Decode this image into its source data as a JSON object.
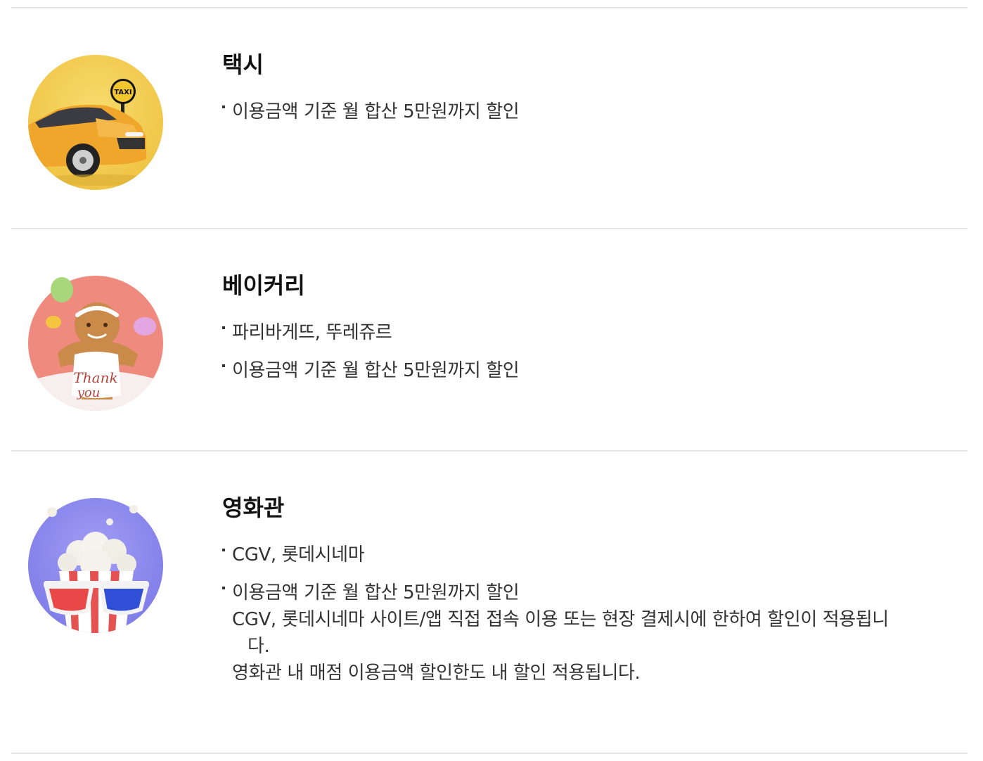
{
  "benefits": [
    {
      "icon": "taxi-icon",
      "title": "택시",
      "items": [
        "이용금액 기준 월 합산 5만원까지 할인"
      ]
    },
    {
      "icon": "bakery-gingerbread-icon",
      "icon_text_line1": "Thank",
      "icon_text_line2": "you",
      "title": "베이커리",
      "items": [
        "파리바게뜨, 뚜레쥬르",
        "이용금액 기준 월 합산 5만원까지 할인"
      ]
    },
    {
      "icon": "cinema-popcorn-icon",
      "title": "영화관",
      "items": [
        "CGV, 롯데시네마",
        "이용금액 기준 월 합산 5만원까지 할인"
      ],
      "notes": [
        "CGV, 롯데시네마 사이트/앱 직접 접속 이용 또는 현장 결제시에 한하여 할인이 적용됩니",
        "다.",
        "영화관 내 매점 이용금액 할인한도 내 할인 적용됩니다."
      ]
    }
  ],
  "taxi_sign_text": "TAXI",
  "colors": {
    "taxi_bg": "#f3cf55",
    "bakery_bg": "#ef8a7f",
    "cinema_bg": "#8e8ef0",
    "divider": "#e6e6e6"
  }
}
